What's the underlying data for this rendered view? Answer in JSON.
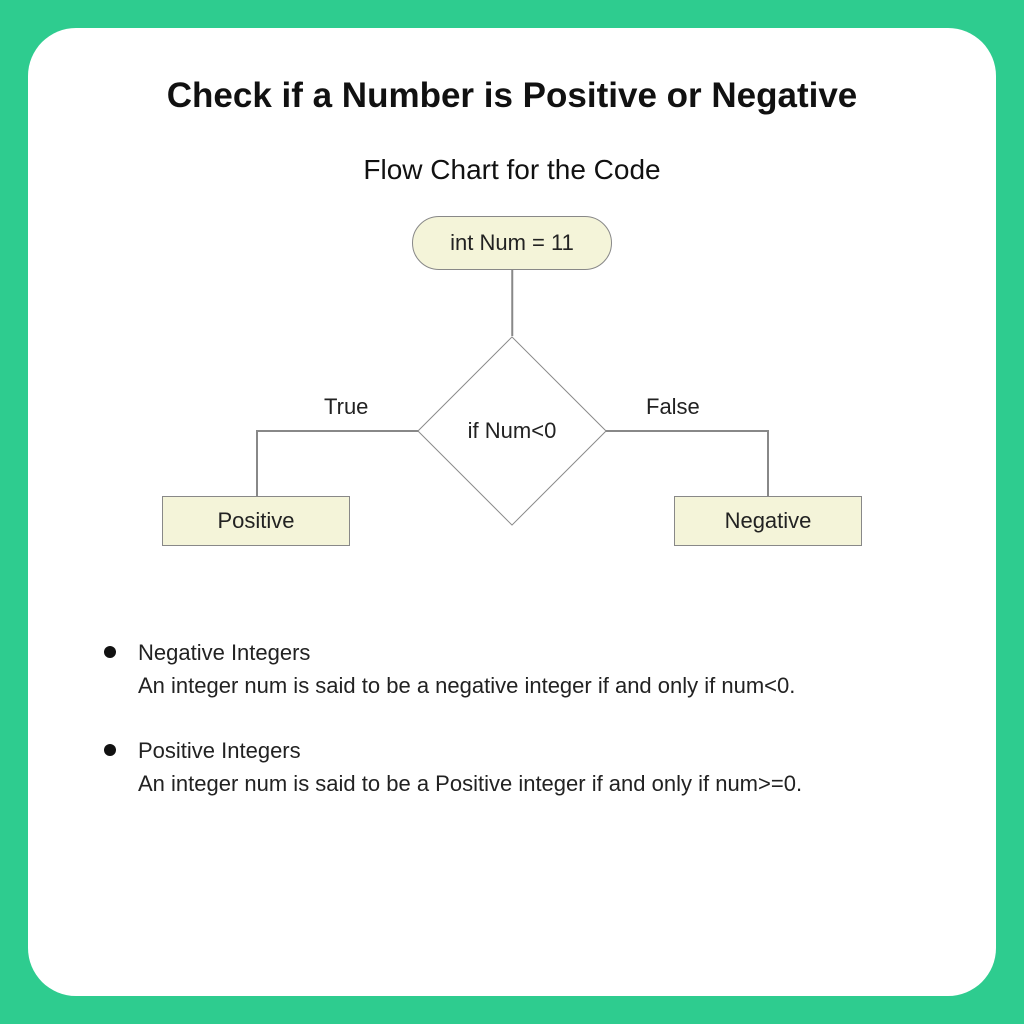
{
  "title": "Check if a Number is Positive or Negative",
  "subtitle": "Flow Chart for the Code",
  "flow": {
    "start": "int Num = 11",
    "decision": "if Num<0",
    "true_label": "True",
    "false_label": "False",
    "left_result": "Positive",
    "right_result": "Negative"
  },
  "bullets": [
    {
      "heading": "Negative Integers",
      "body": "An integer num is said to be a negative integer if and only if num<0."
    },
    {
      "heading": "Positive Integers",
      "body": "An integer num is said to be a Positive integer if and only if num>=0."
    }
  ]
}
